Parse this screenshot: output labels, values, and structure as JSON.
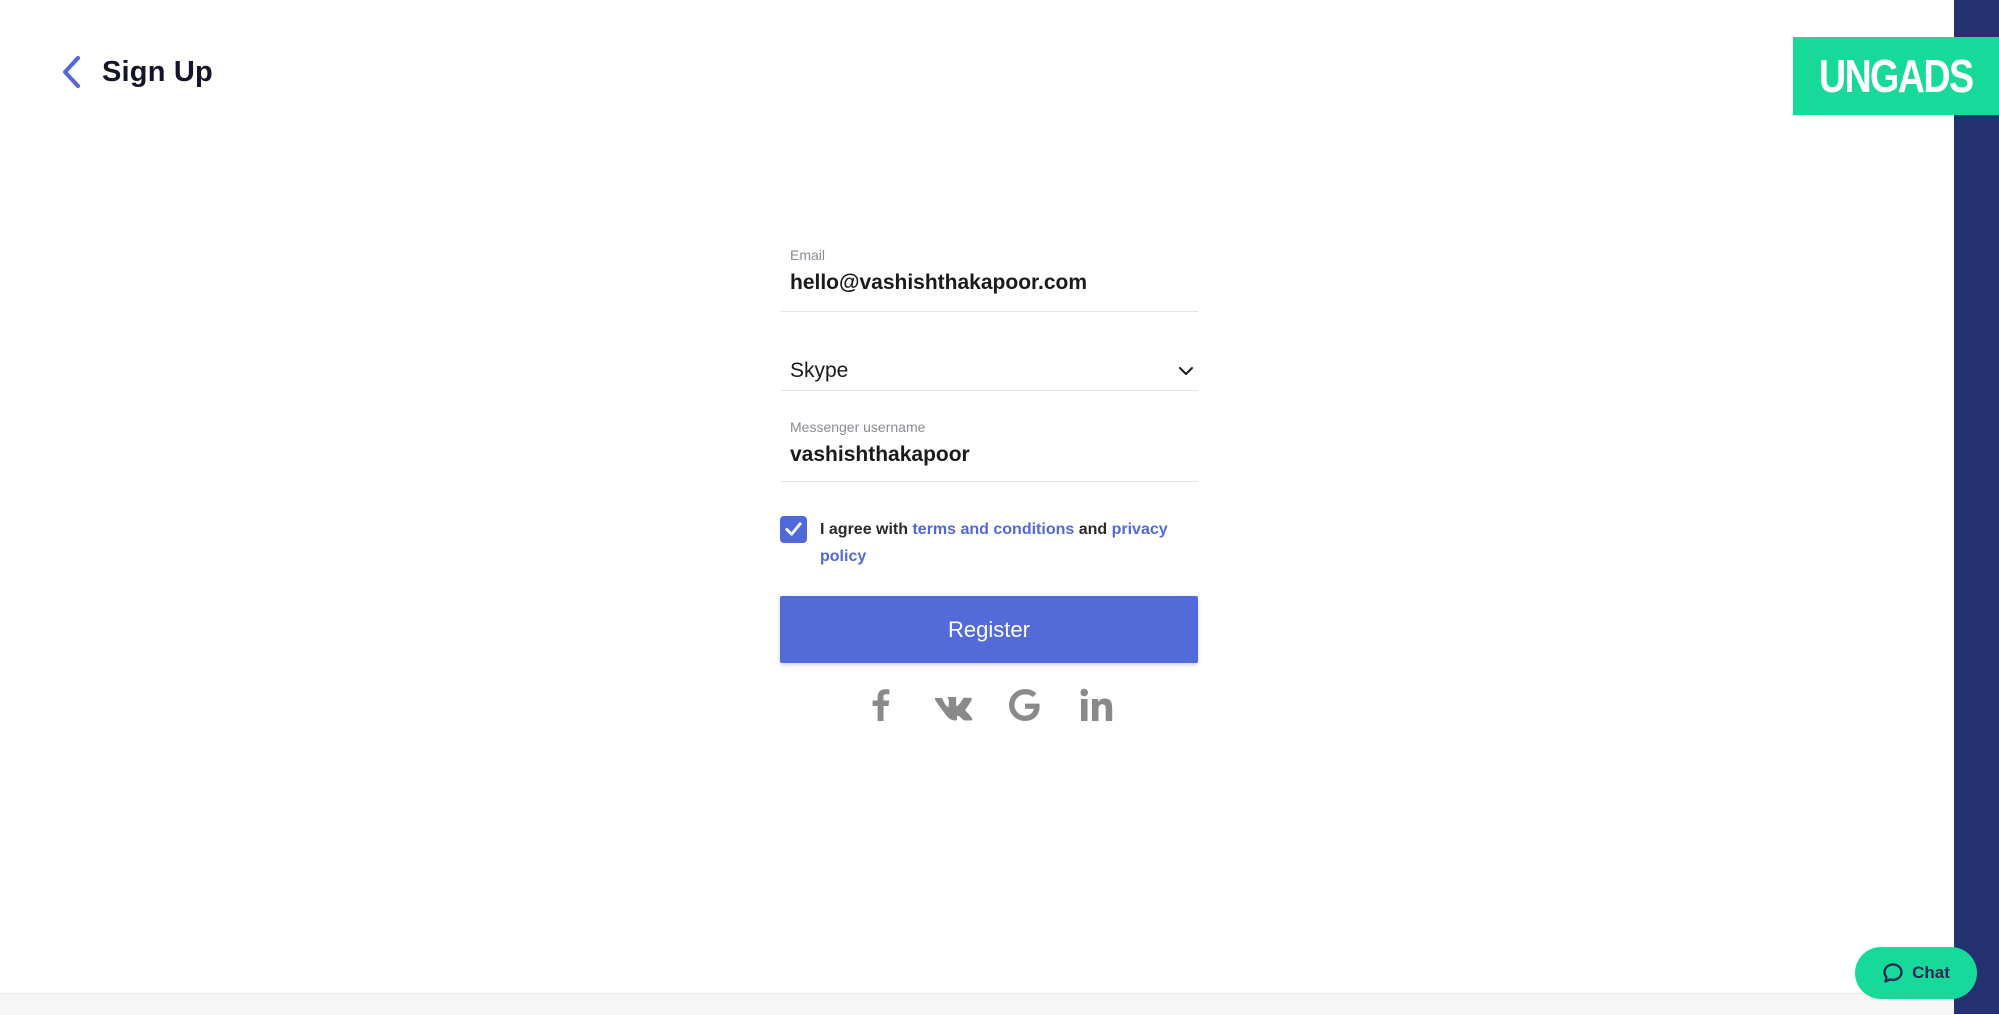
{
  "header": {
    "title": "Sign Up",
    "back_icon": "chevron-left-icon"
  },
  "brand": {
    "logo_text": "UNGADS",
    "logo_color": "#17d99a",
    "sidebar_color": "#243170"
  },
  "form": {
    "email": {
      "label": "Email",
      "value": "hello@vashishthakapoor.com"
    },
    "messenger_select": {
      "selected": "Skype"
    },
    "messenger_username": {
      "label": "Messenger username",
      "value": "vashishthakapoor"
    },
    "agree": {
      "checked": true,
      "prefix": "I agree with ",
      "terms_link": "terms and conditions",
      "middle": " and ",
      "privacy_link": "privacy policy"
    },
    "register_label": "Register",
    "accent_color": "#536ad9"
  },
  "social": [
    "facebook-icon",
    "vk-icon",
    "google-icon",
    "linkedin-icon"
  ],
  "chat": {
    "label": "Chat"
  }
}
